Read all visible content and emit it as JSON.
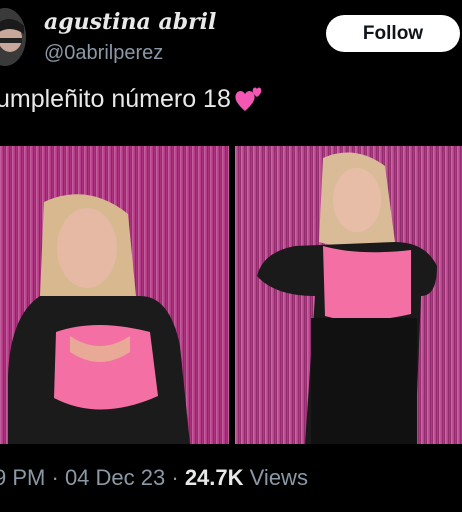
{
  "header": {
    "display_name": "agustina abril",
    "handle": "@0abrilperez",
    "follow_label": "Follow"
  },
  "tweet": {
    "text": "umpleñito número 18",
    "emoji": "pink-hearts-emoji"
  },
  "media": [
    {
      "name": "photo-left",
      "description_icon": "photo"
    },
    {
      "name": "photo-right",
      "description_icon": "photo"
    }
  ],
  "meta": {
    "time": "9 PM",
    "separator": "·",
    "date": "04 Dec 23",
    "views_count": "24.7K",
    "views_label": "Views"
  },
  "colors": {
    "background": "#000000",
    "text": "#e7e9ea",
    "secondary_text": "#8b98a5",
    "follow_bg": "#ffffff",
    "tinsel": "#b0307e",
    "top_pink": "#f36fa4"
  }
}
